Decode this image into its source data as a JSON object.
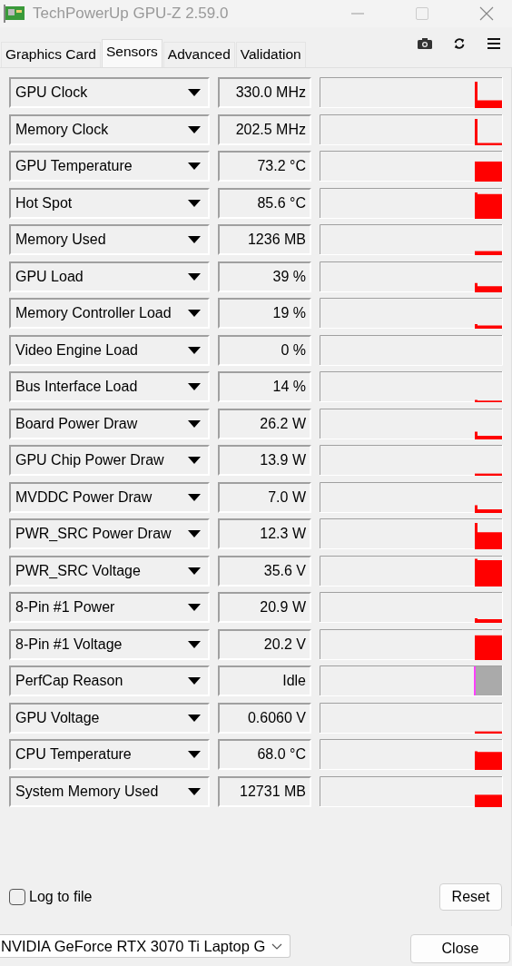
{
  "window": {
    "title": "TechPowerUp GPU-Z 2.59.0"
  },
  "tabs": [
    {
      "label": "Graphics Card",
      "selected": false
    },
    {
      "label": "Sensors",
      "selected": true
    },
    {
      "label": "Advanced",
      "selected": false
    },
    {
      "label": "Validation",
      "selected": false
    }
  ],
  "sensors": [
    {
      "name": "GPU Clock",
      "value": "330.0 MHz"
    },
    {
      "name": "Memory Clock",
      "value": "202.5 MHz"
    },
    {
      "name": "GPU Temperature",
      "value": "73.2 °C"
    },
    {
      "name": "Hot Spot",
      "value": "85.6 °C"
    },
    {
      "name": "Memory Used",
      "value": "1236 MB"
    },
    {
      "name": "GPU Load",
      "value": "39 %"
    },
    {
      "name": "Memory Controller Load",
      "value": "19 %"
    },
    {
      "name": "Video Engine Load",
      "value": "0 %"
    },
    {
      "name": "Bus Interface Load",
      "value": "14 %"
    },
    {
      "name": "Board Power Draw",
      "value": "26.2 W"
    },
    {
      "name": "GPU Chip Power Draw",
      "value": "13.9 W"
    },
    {
      "name": "MVDDC Power Draw",
      "value": "7.0 W"
    },
    {
      "name": "PWR_SRC Power Draw",
      "value": "12.3 W"
    },
    {
      "name": "PWR_SRC Voltage",
      "value": "35.6 V"
    },
    {
      "name": "8-Pin #1 Power",
      "value": "20.9 W"
    },
    {
      "name": "8-Pin #1 Voltage",
      "value": "20.2 V"
    },
    {
      "name": "PerfCap Reason",
      "value": "Idle"
    },
    {
      "name": "GPU Voltage",
      "value": "0.6060 V"
    },
    {
      "name": "CPU Temperature",
      "value": "68.0 °C"
    },
    {
      "name": "System Memory Used",
      "value": "12731 MB"
    }
  ],
  "log_to_file": {
    "label": "Log to file",
    "checked": false
  },
  "reset_button": "Reset",
  "gpu_selector": {
    "value": "NVIDIA GeForce RTX 3070 Ti Laptop G"
  },
  "close_button": "Close"
}
